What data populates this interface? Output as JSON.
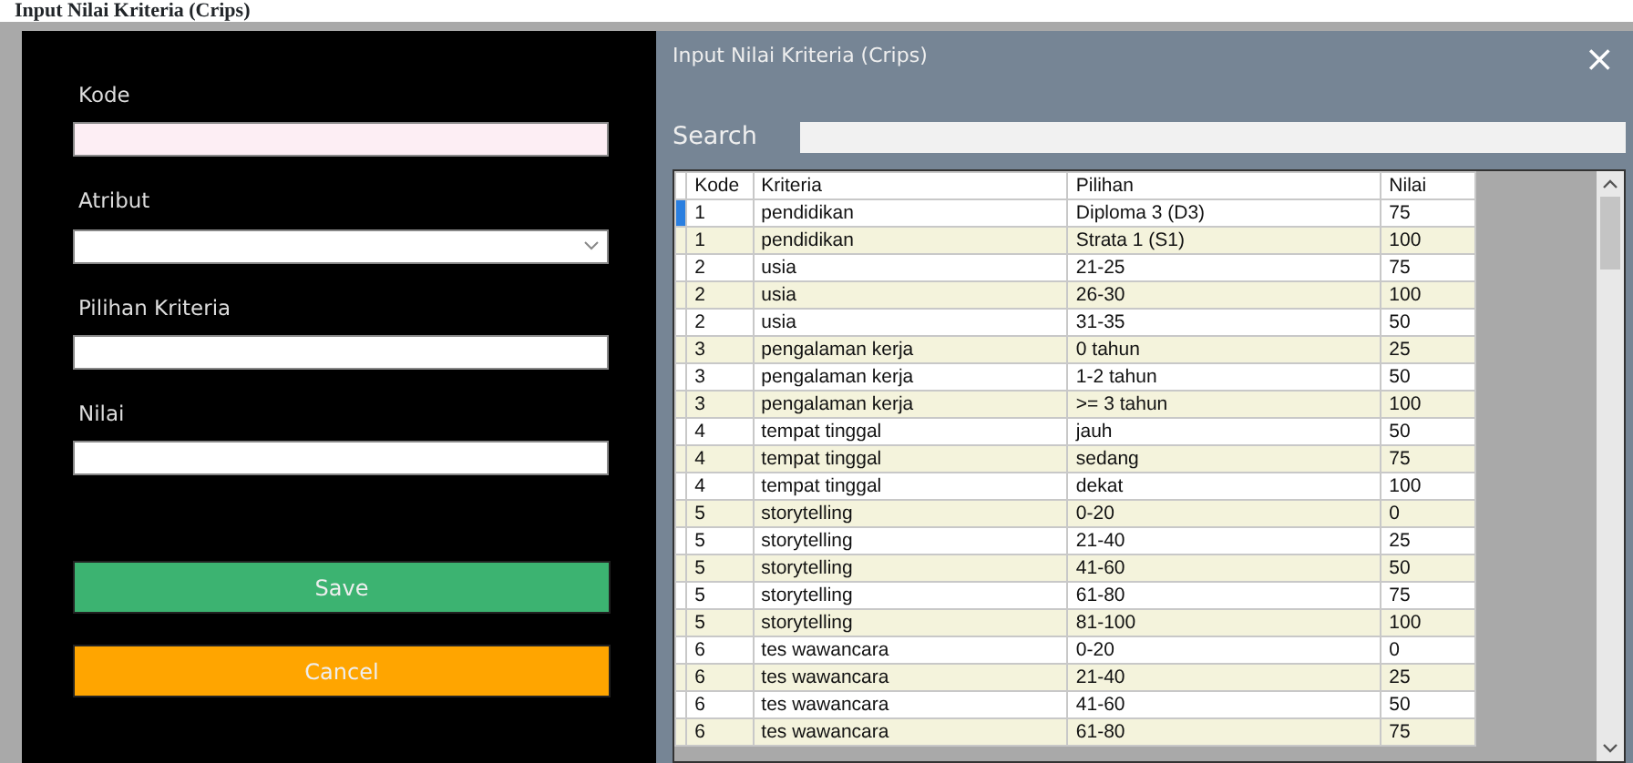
{
  "caption": "Input Nilai Kriteria (Crips)",
  "form": {
    "fields": [
      {
        "label": "Kode",
        "kind": "text",
        "focused": true
      },
      {
        "label": "Atribut",
        "kind": "select",
        "focused": false
      },
      {
        "label": "Pilihan Kriteria",
        "kind": "text",
        "focused": false
      },
      {
        "label": "Nilai",
        "kind": "text",
        "focused": false
      }
    ],
    "buttons": [
      {
        "label": "Save",
        "kind": "save"
      },
      {
        "label": "Cancel",
        "kind": "cancel"
      }
    ]
  },
  "window": {
    "title": "Input Nilai Kriteria (Crips)",
    "close": "×"
  },
  "search": {
    "label": "Search"
  },
  "table": {
    "columns": [
      "Kode",
      "Kriteria",
      "Pilihan",
      "Nilai"
    ],
    "rows": [
      {
        "cells": [
          "1",
          "pendidikan",
          "Diploma 3 (D3)",
          "75"
        ],
        "selected": true
      },
      {
        "cells": [
          "1",
          "pendidikan",
          "Strata 1 (S1)",
          "100"
        ],
        "selected": false
      },
      {
        "cells": [
          "2",
          "usia",
          "21-25",
          "75"
        ],
        "selected": false
      },
      {
        "cells": [
          "2",
          "usia",
          "26-30",
          "100"
        ],
        "selected": false
      },
      {
        "cells": [
          "2",
          "usia",
          "31-35",
          "50"
        ],
        "selected": false
      },
      {
        "cells": [
          "3",
          "pengalaman kerja",
          "0 tahun",
          "25"
        ],
        "selected": false
      },
      {
        "cells": [
          "3",
          "pengalaman kerja",
          "1-2 tahun",
          "50"
        ],
        "selected": false
      },
      {
        "cells": [
          "3",
          "pengalaman kerja",
          ">= 3 tahun",
          "100"
        ],
        "selected": false
      },
      {
        "cells": [
          "4",
          "tempat tinggal",
          "jauh",
          "50"
        ],
        "selected": false
      },
      {
        "cells": [
          "4",
          "tempat tinggal",
          "sedang",
          "75"
        ],
        "selected": false
      },
      {
        "cells": [
          "4",
          "tempat tinggal",
          "dekat",
          "100"
        ],
        "selected": false
      },
      {
        "cells": [
          "5",
          "storytelling",
          "0-20",
          "0"
        ],
        "selected": false
      },
      {
        "cells": [
          "5",
          "storytelling",
          "21-40",
          "25"
        ],
        "selected": false
      },
      {
        "cells": [
          "5",
          "storytelling",
          "41-60",
          "50"
        ],
        "selected": false
      },
      {
        "cells": [
          "5",
          "storytelling",
          "61-80",
          "75"
        ],
        "selected": false
      },
      {
        "cells": [
          "5",
          "storytelling",
          "81-100",
          "100"
        ],
        "selected": false
      },
      {
        "cells": [
          "6",
          "tes wawancara",
          "0-20",
          "0"
        ],
        "selected": false
      },
      {
        "cells": [
          "6",
          "tes wawancara",
          "21-40",
          "25"
        ],
        "selected": false
      },
      {
        "cells": [
          "6",
          "tes wawancara",
          "41-60",
          "50"
        ],
        "selected": false
      },
      {
        "cells": [
          "6",
          "tes wawancara",
          "61-80",
          "75"
        ],
        "selected": false
      }
    ]
  }
}
